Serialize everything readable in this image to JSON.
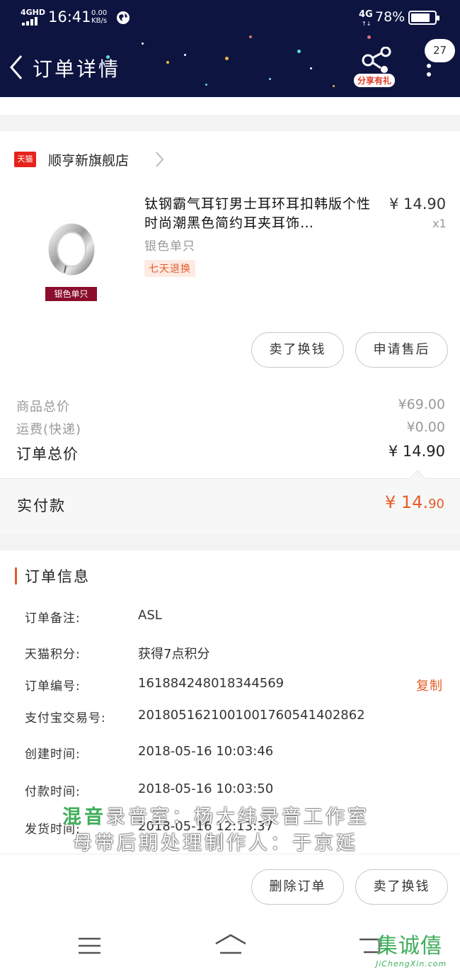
{
  "status_bar": {
    "network": "4GHD",
    "time": "16:41",
    "speed_value": "0.00",
    "speed_unit": "KB/s",
    "network_right": "4G",
    "network_right_arrows": "↑↓",
    "battery": "78%"
  },
  "header": {
    "title": "订单详情",
    "share_label": "分享有礼",
    "message_count": "27"
  },
  "shop": {
    "platform_badge": "天猫",
    "name": "顺亨新旗舰店"
  },
  "product": {
    "title": "钛钢霸气耳钉男士耳环耳扣韩版个性时尚潮黑色简约耳夹耳饰…",
    "image_label": "银色单只",
    "price": "¥ 14.90",
    "quantity": "x1",
    "variant": "银色单只",
    "return_policy": "七天退换"
  },
  "actions": {
    "sell_for_cash": "卖了换钱",
    "after_sale": "申请售后"
  },
  "summary": {
    "goods_total_label": "商品总价",
    "goods_total": "¥69.00",
    "shipping_label": "运费(快递)",
    "shipping": "¥0.00",
    "order_total_label": "订单总价",
    "order_total": "¥ 14.90",
    "paid_label": "实付款",
    "paid_int": "¥ 14.",
    "paid_dec": "90"
  },
  "order_info": {
    "title": "订单信息",
    "rows": [
      {
        "label": "订单备注:",
        "value": "ASL"
      },
      {
        "label": "天猫积分:",
        "value": "获得7点积分"
      },
      {
        "label": "订单编号:",
        "value": "161884248018344569"
      },
      {
        "label": "支付宝交易号:",
        "value": "2018051621001001760541402862"
      },
      {
        "label": "创建时间:",
        "value": "2018-05-16 10:03:46"
      },
      {
        "label": "付款时间:",
        "value": "2018-05-16 10:03:50"
      },
      {
        "label": "发货时间:",
        "value": "2018-05-16 12:13:37"
      }
    ],
    "copy_label": "复制"
  },
  "watermark": {
    "green": "混音",
    "line1": "录音室：杨大纬录音工作室",
    "line2": "母带后期处理制作人：于京延"
  },
  "bottom_actions": {
    "delete": "删除订单",
    "sell_for_cash": "卖了换钱"
  },
  "site_logo": {
    "chars": "集诚僖",
    "url": "JiChengXin.com"
  },
  "colors": {
    "header_bg": "#0d1440",
    "accent": "#e65c2a",
    "tmall_red": "#e7221b"
  }
}
